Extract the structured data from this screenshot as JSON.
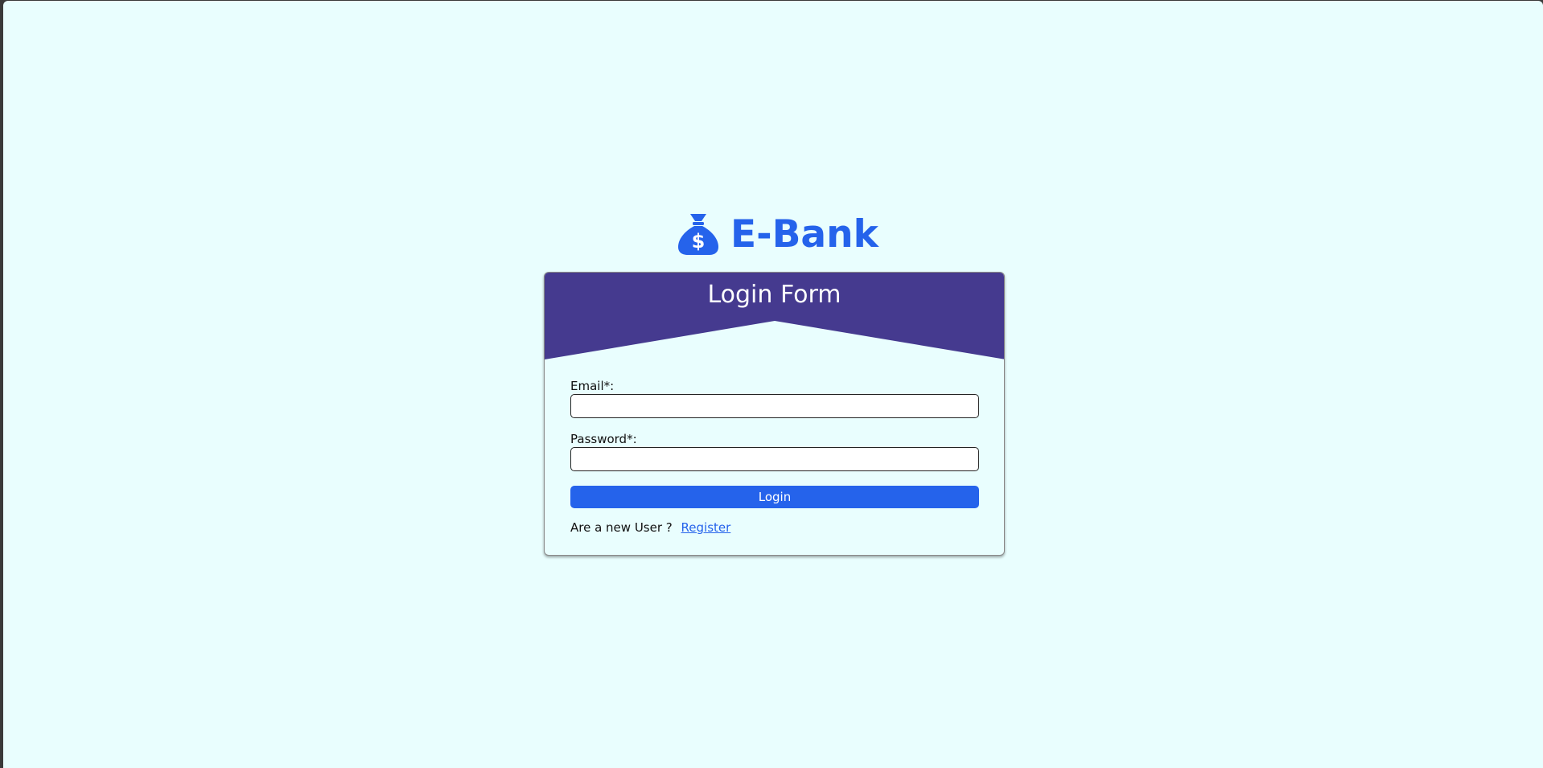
{
  "brand": {
    "name": "E-Bank",
    "icon": "money-bag-icon",
    "color": "#2563eb"
  },
  "form": {
    "title": "Login Form",
    "header_color": "#453a8f",
    "email_label": "Email*:",
    "email_value": "",
    "password_label": "Password*:",
    "password_value": "",
    "login_label": "Login",
    "new_user_text": "Are a new User ?",
    "register_label": "Register"
  },
  "colors": {
    "background": "#e9fefe",
    "button": "#2563eb",
    "link": "#2563eb"
  }
}
